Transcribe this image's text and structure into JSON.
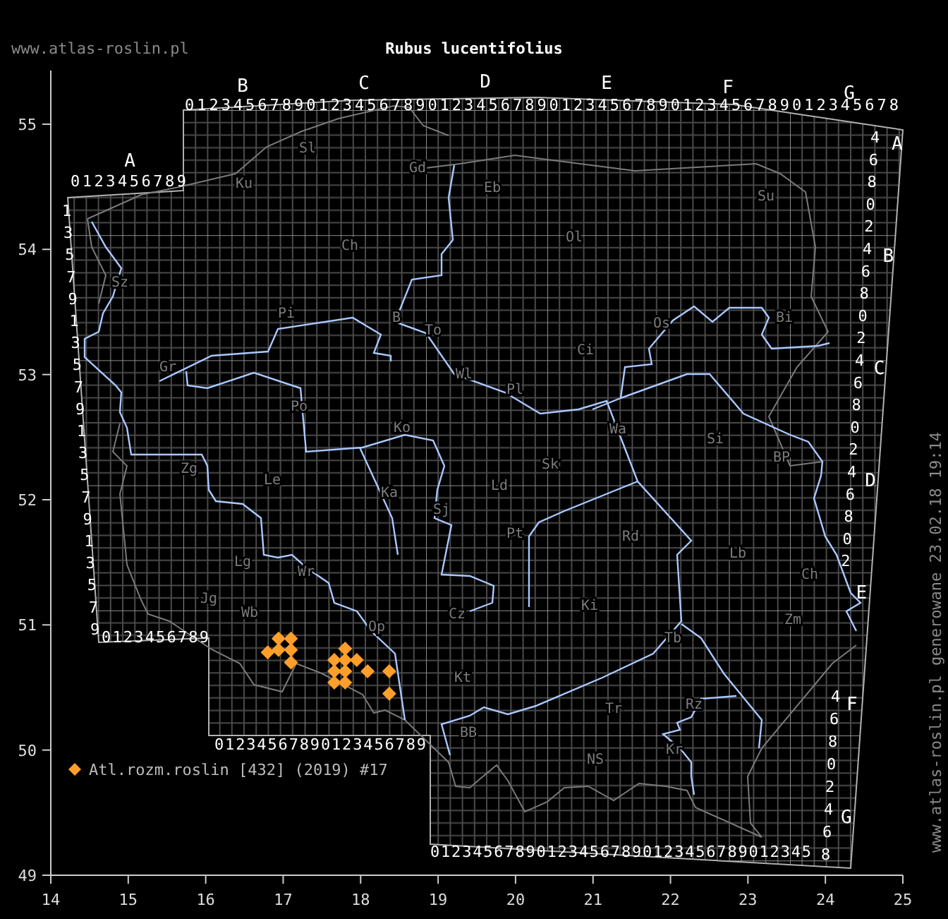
{
  "header": {
    "site": "www.atlas-roslin.pl",
    "title": "Rubus lucentifolius"
  },
  "side_note": "www.atlas-roslin.pl generowane 23.02.18 19:14",
  "map": {
    "top_letters": [
      "B",
      "C",
      "D",
      "E",
      "F",
      "G"
    ],
    "top_digits": "01234567890123456789012345678901234567890123456789012345678",
    "west_letter": "A",
    "west_digits": "0123456789",
    "left_digits": [
      "1",
      "3",
      "5",
      "7",
      "9",
      "1",
      "3",
      "5",
      "7",
      "9",
      "1",
      "3",
      "5",
      "7",
      "9",
      "1",
      "3",
      "5",
      "7",
      "9"
    ],
    "bottom_left_digits": "0123456789",
    "bottom_middle_digits": "01234567890123456789",
    "bottom_right_digits": "012345678901234567890123456789012345",
    "right_upper_letters": [
      "A",
      "B",
      "C",
      "D",
      "E"
    ],
    "right_upper_digits": [
      "4",
      "6",
      "8",
      "0",
      "2",
      "4",
      "6",
      "8",
      "0",
      "2",
      "4",
      "6",
      "8",
      "0",
      "2",
      "4",
      "6",
      "8",
      "0",
      "2"
    ],
    "right_lower_letters": [
      "F",
      "G"
    ],
    "right_lower_digits": [
      "4",
      "6",
      "8",
      "0",
      "2",
      "4",
      "6",
      "8"
    ],
    "region_labels": [
      "Sl",
      "Gd",
      "Ku",
      "Eb",
      "Su",
      "Ol",
      "Ch",
      "Sz",
      "Pi",
      "B",
      "Bi",
      "Os",
      "To",
      "Ci",
      "Gr",
      "Wl",
      "Pl",
      "Po",
      "Ko",
      "Wa",
      "Si",
      "BP",
      "Sk",
      "Zg",
      "Le",
      "Ld",
      "Ka",
      "Sj",
      "Pt",
      "Rd",
      "Lb",
      "Lg",
      "Wr",
      "Ch",
      "Jg",
      "Wb",
      "Cz",
      "Ki",
      "Op",
      "Zm",
      "Tb",
      "Kt",
      "Rz",
      "Tr",
      "BB",
      "Kr",
      "NS"
    ],
    "chart_data": {
      "type": "scatter",
      "xlim": [
        14,
        25
      ],
      "ylim": [
        49,
        55.4
      ],
      "xticks": [
        14,
        15,
        16,
        17,
        18,
        19,
        20,
        21,
        22,
        23,
        24,
        25
      ],
      "yticks": [
        49,
        50,
        51,
        52,
        53,
        54,
        55
      ],
      "x": [
        16.8,
        16.94,
        17.1,
        16.94,
        17.1,
        17.1,
        17.8,
        17.66,
        17.8,
        17.95,
        17.66,
        17.8,
        18.09,
        18.37,
        17.66,
        17.8,
        18.37
      ],
      "series": [
        {
          "name": "Atl.rozm.roslin [432] (2019) #17",
          "color": "#ff9f2a",
          "values": [
            50.78,
            50.89,
            50.89,
            50.8,
            50.8,
            50.7,
            50.81,
            50.72,
            50.72,
            50.72,
            50.63,
            50.63,
            50.63,
            50.63,
            50.54,
            50.54,
            50.45
          ]
        }
      ]
    }
  }
}
